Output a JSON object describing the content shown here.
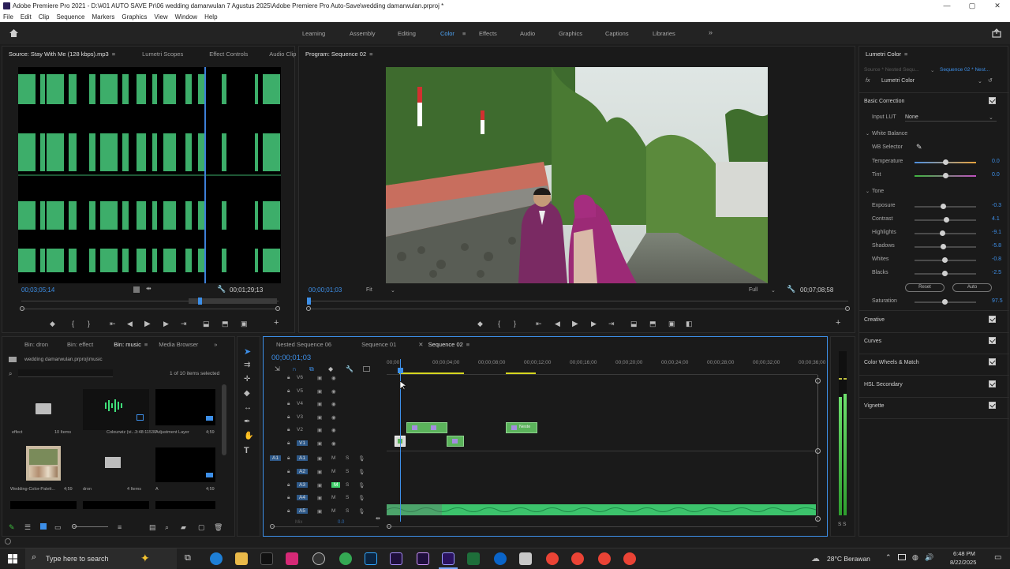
{
  "window": {
    "title": "Adobe Premiere Pro 2021 - D:\\#01 AUTO SAVE Pr\\06 wedding damarwulan 7 Agustus 2025\\Adobe Premiere Pro Auto-Save\\wedding damarwulan.prproj *",
    "controls": [
      "—",
      "▢",
      "✕"
    ]
  },
  "menu": [
    "File",
    "Edit",
    "Clip",
    "Sequence",
    "Markers",
    "Graphics",
    "View",
    "Window",
    "Help"
  ],
  "workspaces": {
    "items": [
      "Learning",
      "Assembly",
      "Editing",
      "Color",
      "Effects",
      "Audio",
      "Graphics",
      "Captions",
      "Libraries"
    ],
    "active": "Color",
    "more": "»"
  },
  "source_panel": {
    "tabs": [
      "Source: Stay With Me (128 kbps).mp3",
      "Lumetri Scopes",
      "Effect Controls",
      "Audio Clip"
    ],
    "timecode_in": "00;03;05;14",
    "timecode_out": "00;01;29;13",
    "playhead_fraction": 0.71
  },
  "program_panel": {
    "title": "Program: Sequence 02",
    "timecode": "00;00;01;03",
    "fit": "Fit",
    "quality": "Full",
    "duration": "00;07;08;58"
  },
  "lumetri": {
    "panel_title": "Lumetri Color",
    "source_clip": "Source * Nested Sequ...",
    "sequence": "Sequence 02 * Nest...",
    "fx_label": "fx",
    "effect": "Lumetri Color",
    "basic_correction": "Basic Correction",
    "input_lut_label": "Input LUT",
    "input_lut_value": "None",
    "white_balance": "White Balance",
    "wb_selector": "WB Selector",
    "temperature": {
      "label": "Temperature",
      "value": "0.0",
      "fraction": 0.5
    },
    "tint": {
      "label": "Tint",
      "value": "0.0",
      "fraction": 0.5
    },
    "tone": "Tone",
    "exposure": {
      "label": "Exposure",
      "value": "-0.3",
      "fraction": 0.47
    },
    "contrast": {
      "label": "Contrast",
      "value": "4.1",
      "fraction": 0.52
    },
    "highlights": {
      "label": "Highlights",
      "value": "-9.1",
      "fraction": 0.45
    },
    "shadows": {
      "label": "Shadows",
      "value": "-5.8",
      "fraction": 0.47
    },
    "whites": {
      "label": "Whites",
      "value": "-0.8",
      "fraction": 0.49
    },
    "blacks": {
      "label": "Blacks",
      "value": "-2.5",
      "fraction": 0.49
    },
    "reset": "Reset",
    "auto": "Auto",
    "saturation": {
      "label": "Saturation",
      "value": "97.5",
      "fraction": 0.49
    },
    "sections": [
      "Creative",
      "Curves",
      "Color Wheels & Match",
      "HSL Secondary",
      "Vignette"
    ]
  },
  "project_panel": {
    "tabs": [
      "Bin: dron",
      "Bin: effect",
      "Bin: music",
      "Media Browser"
    ],
    "active_tab": "Bin: music",
    "path": "wedding damarwulan.prproj\\music",
    "count": "1 of 10 items selected",
    "items": [
      {
        "name": "effect",
        "meta": "10 Items"
      },
      {
        "name": "Colourwiz (vi...",
        "meta": "3:48:11530"
      },
      {
        "name": "Adjustment Layer",
        "meta": "4;59"
      },
      {
        "name": "Wedding-Color-Palett...",
        "meta": "4;59"
      },
      {
        "name": "dron",
        "meta": "4 Items"
      },
      {
        "name": "A",
        "meta": "4;59"
      }
    ]
  },
  "timeline": {
    "tabs": [
      "Nested Sequence 06",
      "Sequence 01",
      "Sequence 02"
    ],
    "active_tab": "Sequence 02",
    "timecode": "00;00;01;03",
    "ruler": [
      "00;00",
      "00;00;04;00",
      "00;00;08;00",
      "00;00;12;00",
      "00;00;16;00",
      "00;00;20;00",
      "00;00;24;00",
      "00;00;28;00",
      "00;00;32;00",
      "00;00;36;00"
    ],
    "video_tracks": [
      "V6",
      "V5",
      "V4",
      "V3",
      "V2",
      "V1"
    ],
    "audio_tracks": [
      "A1",
      "A2",
      "A3",
      "A4",
      "A5"
    ],
    "source_patch": "A1",
    "mix_label": "Mix",
    "mix_value": "0.0",
    "clip_label": "Neste",
    "playhead_fraction": 0.031
  },
  "audio_meter": {
    "label": "S S"
  },
  "taskbar": {
    "search_placeholder": "Type here to search",
    "weather": "28°C  Berawan",
    "time": "6:48 PM",
    "date": "8/22/2025"
  },
  "colors": {
    "accent": "#3d8fe8",
    "clip_green": "#5bb35b",
    "waveform_green": "#3dae6a",
    "temperature_gradient": [
      "#4d8fe0",
      "#e8a23c"
    ],
    "tint_gradient": [
      "#3fb53f",
      "#c050c0"
    ]
  }
}
